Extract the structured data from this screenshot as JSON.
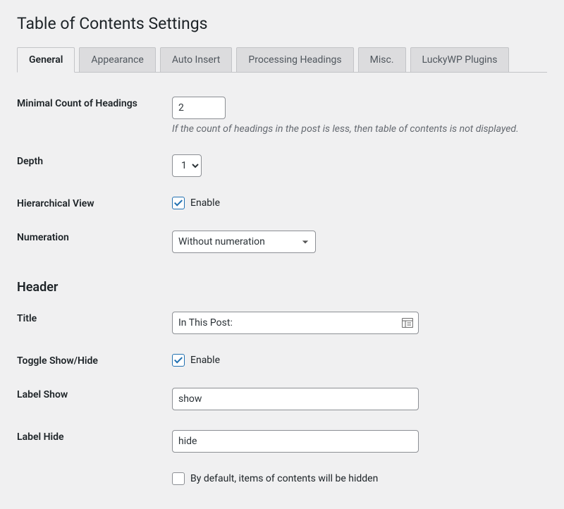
{
  "page_title": "Table of Contents Settings",
  "tabs": [
    {
      "label": "General",
      "active": true
    },
    {
      "label": "Appearance",
      "active": false
    },
    {
      "label": "Auto Insert",
      "active": false
    },
    {
      "label": "Processing Headings",
      "active": false
    },
    {
      "label": "Misc.",
      "active": false
    },
    {
      "label": "LuckyWP Plugins",
      "active": false
    }
  ],
  "fields": {
    "min_count": {
      "label": "Minimal Count of Headings",
      "value": "2",
      "description": "If the count of headings in the post is less, then table of contents is not displayed."
    },
    "depth": {
      "label": "Depth",
      "value": "1"
    },
    "hierarchical": {
      "label": "Hierarchical View",
      "checkbox_label": "Enable",
      "checked": true
    },
    "numeration": {
      "label": "Numeration",
      "value": "Without numeration"
    }
  },
  "header_section": {
    "heading": "Header",
    "title": {
      "label": "Title",
      "value": "In This Post:"
    },
    "toggle": {
      "label": "Toggle Show/Hide",
      "checkbox_label": "Enable",
      "checked": true
    },
    "label_show": {
      "label": "Label Show",
      "value": "show"
    },
    "label_hide": {
      "label": "Label Hide",
      "value": "hide"
    },
    "default_hidden": {
      "checkbox_label": "By default, items of contents will be hidden",
      "checked": false
    }
  }
}
